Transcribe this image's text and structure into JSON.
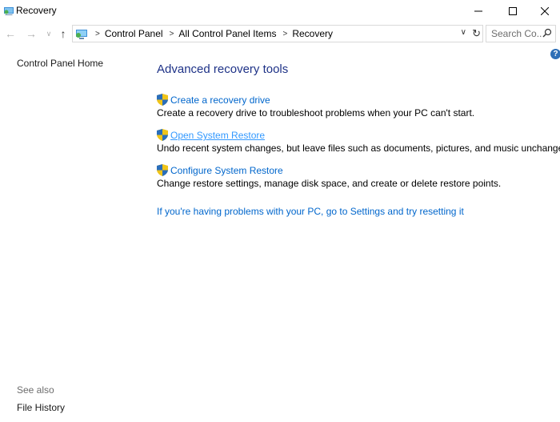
{
  "window": {
    "title": "Recovery",
    "minimize_glyph": "—",
    "maximize_glyph": "☐",
    "close_glyph": "✕"
  },
  "nav": {
    "back_glyph": "←",
    "forward_glyph": "→",
    "recent_glyph": "∨",
    "up_glyph": "↑",
    "breadcrumbs": [
      "Control Panel",
      "All Control Panel Items",
      "Recovery"
    ],
    "separator": ">",
    "dropdown_glyph": "∨",
    "refresh_glyph": "↻",
    "search_placeholder": "Search Co..."
  },
  "left_pane": {
    "home_link": "Control Panel Home",
    "see_also": "See also",
    "file_history": "File History"
  },
  "help_glyph": "?",
  "main": {
    "heading": "Advanced recovery tools",
    "items": [
      {
        "label": "Create a recovery drive",
        "description": "Create a recovery drive to troubleshoot problems when your PC can't start."
      },
      {
        "label": "Open System Restore",
        "description": "Undo recent system changes, but leave files such as documents, pictures, and music unchanged."
      },
      {
        "label": "Configure System Restore",
        "description": "Change restore settings, manage disk space, and create or delete restore points."
      }
    ],
    "reset_link": "If you're having problems with your PC, go to Settings and try resetting it"
  },
  "icons": {
    "shield": "uac-shield-icon",
    "title": "recovery-icon",
    "search": "search-icon",
    "help": "help-icon"
  },
  "colors": {
    "link": "#0066cc",
    "heading": "#1e3287",
    "hover_link": "#3399ff"
  }
}
